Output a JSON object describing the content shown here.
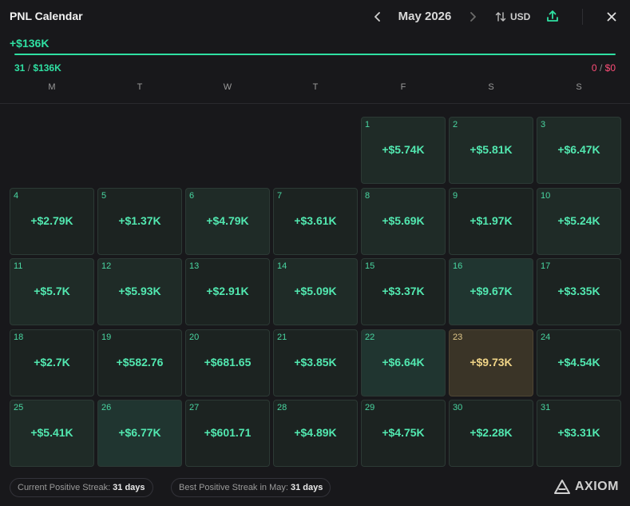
{
  "header": {
    "title": "PNL Calendar",
    "month": "May 2026",
    "prev_icon": "chevron-left-icon",
    "next_icon": "chevron-right-icon",
    "currency": "USD",
    "sort_icon": "sort-arrows-icon",
    "share_icon": "share-upload-icon",
    "close_icon": "close-icon"
  },
  "summary": {
    "total": "+$136K",
    "positive_days": "31",
    "positive_total": "$136K",
    "negative_days": "0",
    "negative_total": "$0",
    "separator": "/",
    "positive_ratio": 1.0
  },
  "weekdays": [
    "M",
    "T",
    "W",
    "T",
    "F",
    "S",
    "S"
  ],
  "calendar": {
    "days": [
      {
        "day": "1",
        "value": "+$5.74K"
      },
      {
        "day": "2",
        "value": "+$5.81K"
      },
      {
        "day": "3",
        "value": "+$6.47K"
      },
      {
        "day": "4",
        "value": "+$2.79K"
      },
      {
        "day": "5",
        "value": "+$1.37K"
      },
      {
        "day": "6",
        "value": "+$4.79K"
      },
      {
        "day": "7",
        "value": "+$3.61K"
      },
      {
        "day": "8",
        "value": "+$5.69K"
      },
      {
        "day": "9",
        "value": "+$1.97K"
      },
      {
        "day": "10",
        "value": "+$5.24K"
      },
      {
        "day": "11",
        "value": "+$5.7K"
      },
      {
        "day": "12",
        "value": "+$5.93K"
      },
      {
        "day": "13",
        "value": "+$2.91K"
      },
      {
        "day": "14",
        "value": "+$5.09K"
      },
      {
        "day": "15",
        "value": "+$3.37K"
      },
      {
        "day": "16",
        "value": "+$9.67K"
      },
      {
        "day": "17",
        "value": "+$3.35K"
      },
      {
        "day": "18",
        "value": "+$2.7K"
      },
      {
        "day": "19",
        "value": "+$582.76"
      },
      {
        "day": "20",
        "value": "+$681.65"
      },
      {
        "day": "21",
        "value": "+$3.85K"
      },
      {
        "day": "22",
        "value": "+$6.64K"
      },
      {
        "day": "23",
        "value": "+$9.73K"
      },
      {
        "day": "24",
        "value": "+$4.54K"
      },
      {
        "day": "25",
        "value": "+$5.41K"
      },
      {
        "day": "26",
        "value": "+$6.77K"
      },
      {
        "day": "27",
        "value": "+$601.71"
      },
      {
        "day": "28",
        "value": "+$4.89K"
      },
      {
        "day": "29",
        "value": "+$4.75K"
      },
      {
        "day": "30",
        "value": "+$2.28K"
      },
      {
        "day": "31",
        "value": "+$3.31K"
      }
    ]
  },
  "footer": {
    "current_streak_label": "Current Positive Streak:",
    "current_streak_value": "31 days",
    "best_streak_label": "Best Positive Streak in May:",
    "best_streak_value": "31 days",
    "logo_text": "AXIOM",
    "logo_icon": "axiom-logo-icon"
  },
  "colors": {
    "positive": "#2fe0a2",
    "negative": "#ff4d78",
    "best_day": "#f0d487",
    "background": "#18181b"
  }
}
